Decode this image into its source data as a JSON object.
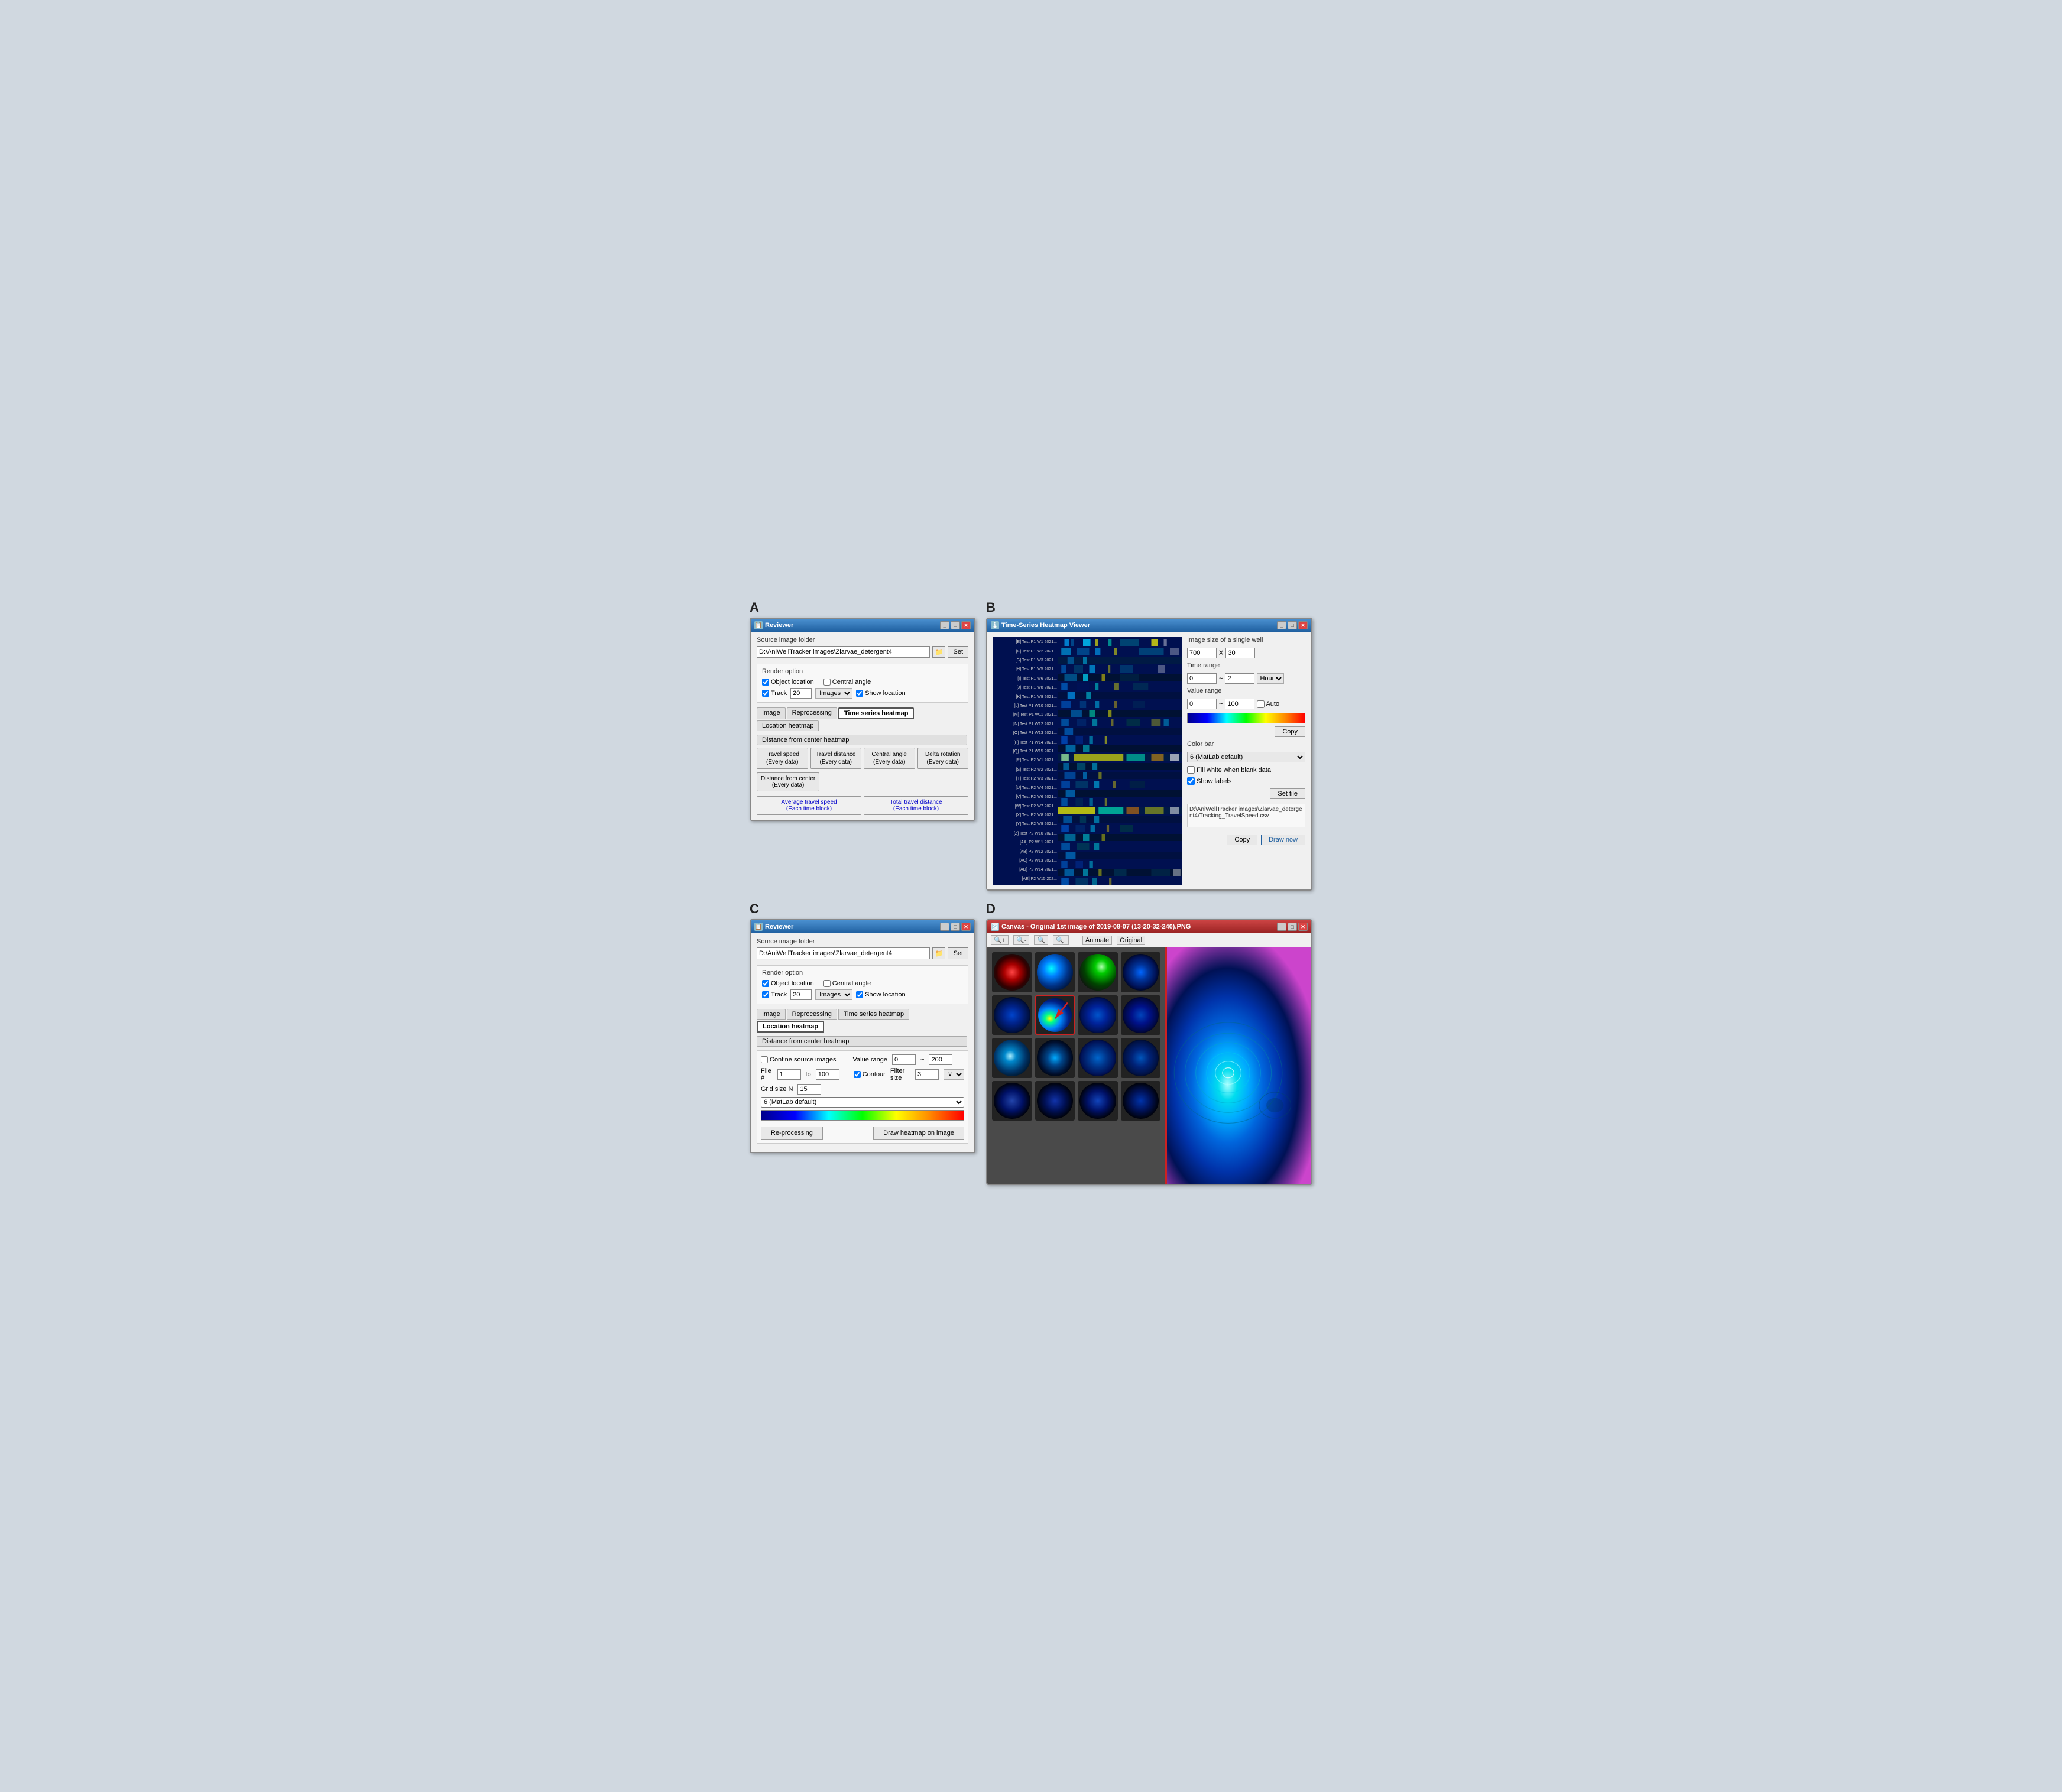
{
  "panels": {
    "A": {
      "label": "A",
      "reviewer": {
        "title": "Reviewer",
        "source_label": "Source image folder",
        "path_value": "D:\\AniWellTracker images\\Zlarvae_detergent4",
        "set_label": "Set",
        "render_label": "Render option",
        "obj_location_label": "Object location",
        "obj_location_checked": true,
        "central_angle_label": "Central angle",
        "central_angle_checked": false,
        "track_label": "Track",
        "track_checked": true,
        "track_value": "20",
        "images_label": "Images",
        "show_location_label": "Show location",
        "show_location_checked": true,
        "tabs": [
          "Image",
          "Reprocessing",
          "Time series heatmap",
          "Location heatmap"
        ],
        "active_tab": "Time series heatmap",
        "dist_tab": "Distance from center heatmap",
        "buttons": [
          {
            "label": "Travel speed\n(Every data)",
            "cols": 1
          },
          {
            "label": "Travel distance\n(Every data)",
            "cols": 1
          },
          {
            "label": "Central angle\n(Every data)",
            "cols": 1
          },
          {
            "label": "Delta rotation\n(Every data)",
            "cols": 1
          }
        ],
        "center_btn_label": "Distance from center\n(Every data)",
        "bottom_btns": [
          {
            "label": "Average travel speed\n(Each time block)",
            "link": true
          },
          {
            "label": "Total travel distance\n(Each time block)",
            "link": true
          }
        ]
      }
    },
    "B": {
      "label": "B",
      "heatmap": {
        "title": "Time-Series Heatmap Viewer",
        "image_size_label": "Image size of a single well",
        "img_width": "700",
        "x_label": "X",
        "img_height": "30",
        "time_range_label": "Time range",
        "time_from": "0",
        "tilde": "~",
        "time_to": "2",
        "hour_label": "Hour",
        "value_range_label": "Value range",
        "val_from": "0",
        "val_to": "100",
        "auto_label": "Auto",
        "auto_checked": false,
        "copy_label": "Copy",
        "colorbar_label": "Color bar",
        "colorbar_value": "6 (MatLab default)",
        "fill_white_label": "Fill white when blank data",
        "fill_white_checked": false,
        "show_labels_label": "Show labels",
        "show_labels_checked": true,
        "set_file_label": "Set file",
        "file_path": "D:\\AniWellTracker images\\Zlarvae_detergent4\\Tracking_TravelSpeed.csv",
        "copy_btn_label": "Copy",
        "draw_btn_label": "Draw now",
        "row_labels": [
          "[E1] Test P1 W1 2021...",
          "[F1] Test P1 W2 2021...",
          "[G1] Test P1 W3 2021...",
          "[H1] Test P1 W5 2021-0...",
          "[I1] Test P1 W6 2021-0...",
          "[J1] Test P1 W8 2021-0...",
          "[K1] Test P1 W9 2021-0...",
          "[L1] Test P1 W10 2021...",
          "[M1] Test P1 W11 2021...",
          "[N1] Test P1 W12 2021...",
          "[O1] Test P1 W13 2021...",
          "[P1] Test P1 W14 2021...",
          "[Q1] Test P1 W15 2021...",
          "[R1] Test P2 W1 2021...",
          "[S1] Test P2 W2 2021...",
          "[T1] Test P2 W3 2021...",
          "[U1] Test P2 W4 2021...",
          "[V1] Test P2 W6 2021...",
          "[W1] Test P2 W7 2021...",
          "[X1] Test P2 W8 2021...",
          "[Y1] Test P2 W9 2021...",
          "[Z1] Test P2 W10 2021...",
          "[AA] Test P2 W11 2021...",
          "[AB] Test P2 W12 2021...",
          "[AC] Test P2 W13 2021...",
          "[AD] Test P2 W14 2021...",
          "[AE] Test P2 W15 202..."
        ]
      }
    },
    "C": {
      "label": "C",
      "reviewer": {
        "title": "Reviewer",
        "source_label": "Source image folder",
        "path_value": "D:\\AniWellTracker images\\Zlarvae_detergent4",
        "set_label": "Set",
        "render_label": "Render option",
        "obj_location_label": "Object location",
        "obj_location_checked": true,
        "central_angle_label": "Central angle",
        "central_angle_checked": false,
        "track_label": "Track",
        "track_checked": true,
        "track_value": "20",
        "images_label": "Images",
        "show_location_label": "Show location",
        "show_location_checked": true,
        "tabs": [
          "Image",
          "Reprocessing",
          "Time series heatmap",
          "Location heatmap"
        ],
        "active_tab": "Location heatmap",
        "dist_tab": "Distance from center heatmap",
        "confine_label": "Confine source images",
        "confine_checked": false,
        "file_num_label": "File #",
        "file_num_from": "1",
        "file_num_to_label": "to",
        "file_num_to": "100",
        "grid_size_label": "Grid size N",
        "grid_size_value": "15",
        "value_range_label": "Value range",
        "val_from": "0",
        "val_to": "200",
        "contour_label": "Contour",
        "contour_checked": true,
        "filter_label": "Filter size",
        "filter_value": "3",
        "colorbar_value": "6 (MatLab default)",
        "reprocess_label": "Re-processing",
        "draw_heatmap_label": "Draw heatmap on image"
      }
    },
    "D": {
      "label": "D",
      "canvas": {
        "title": "Canvas - Original 1st image of 2019-08-07 (13-20-32-240).PNG",
        "animate_label": "Animate",
        "original_label": "Original"
      }
    }
  }
}
